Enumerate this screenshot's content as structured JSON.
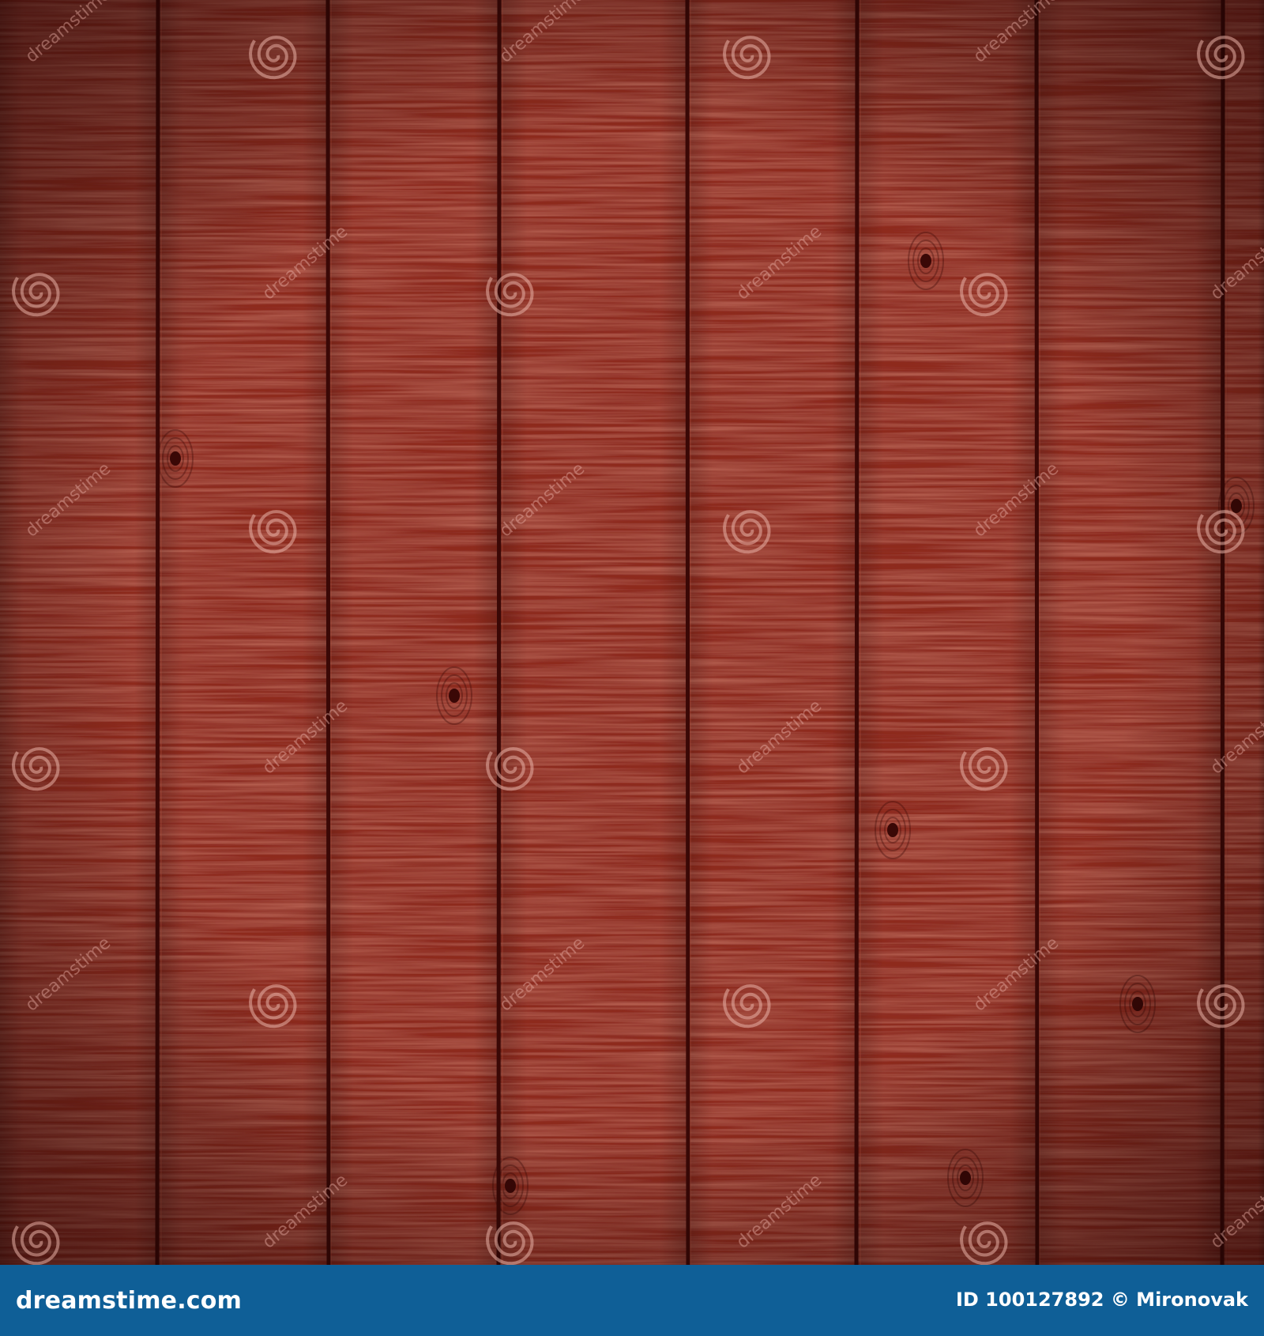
{
  "image": {
    "subject": "red-stained-vertical-wood-planks",
    "base_color": "#8e2a1f",
    "dark_seam_color": "#3a0806",
    "highlight_color": "#b8503d"
  },
  "watermark": {
    "icon": "spiral-logo-icon",
    "diagonal_text": "dreamstime",
    "color": "#e8b0a6"
  },
  "footer": {
    "brand": "dreamstime.com",
    "credit": "ID 100127892 © Mironovak",
    "bar_color": "#0f5f97"
  }
}
